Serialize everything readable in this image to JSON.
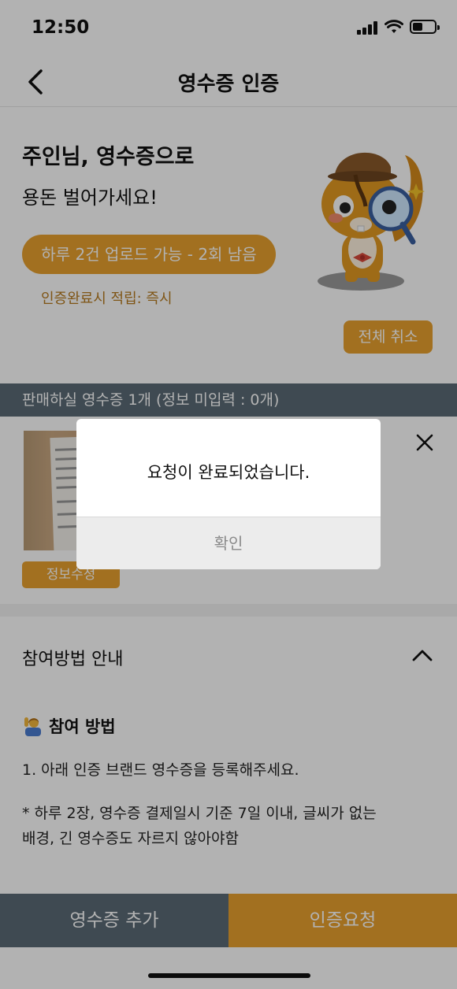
{
  "status_bar": {
    "time": "12:50"
  },
  "nav": {
    "title": "영수증 인증"
  },
  "hero": {
    "title": "주인님, 영수증으로",
    "subtitle": "용돈 벌어가세요!",
    "limit_label": "하루 2건 업로드 가능 - 2회 남음",
    "reward_note": "인증완료시 적립: 즉시",
    "cancel_all_label": "전체 취소"
  },
  "section_bar": {
    "label": "판매하실 영수증 1개 (정보 미입력 : 0개)"
  },
  "receipt": {
    "edit_label": "정보수정"
  },
  "guide": {
    "title": "참여방법 안내",
    "method_heading": "참여 방법",
    "step1": "1. 아래 인증 브랜드 영수증을 등록해주세요.",
    "note_line1": "* 하루 2장, 영수증 결제일시 기준 7일 이내, 글씨가 없는",
    "note_line2": "배경, 긴 영수증도 자르지 않아야함"
  },
  "bottom": {
    "add_label": "영수증 추가",
    "request_label": "인증요청"
  },
  "dialog": {
    "message": "요청이 완료되었습니다.",
    "confirm_label": "확인"
  },
  "colors": {
    "accent": "#e8a12e",
    "slate": "#5b6b76"
  }
}
